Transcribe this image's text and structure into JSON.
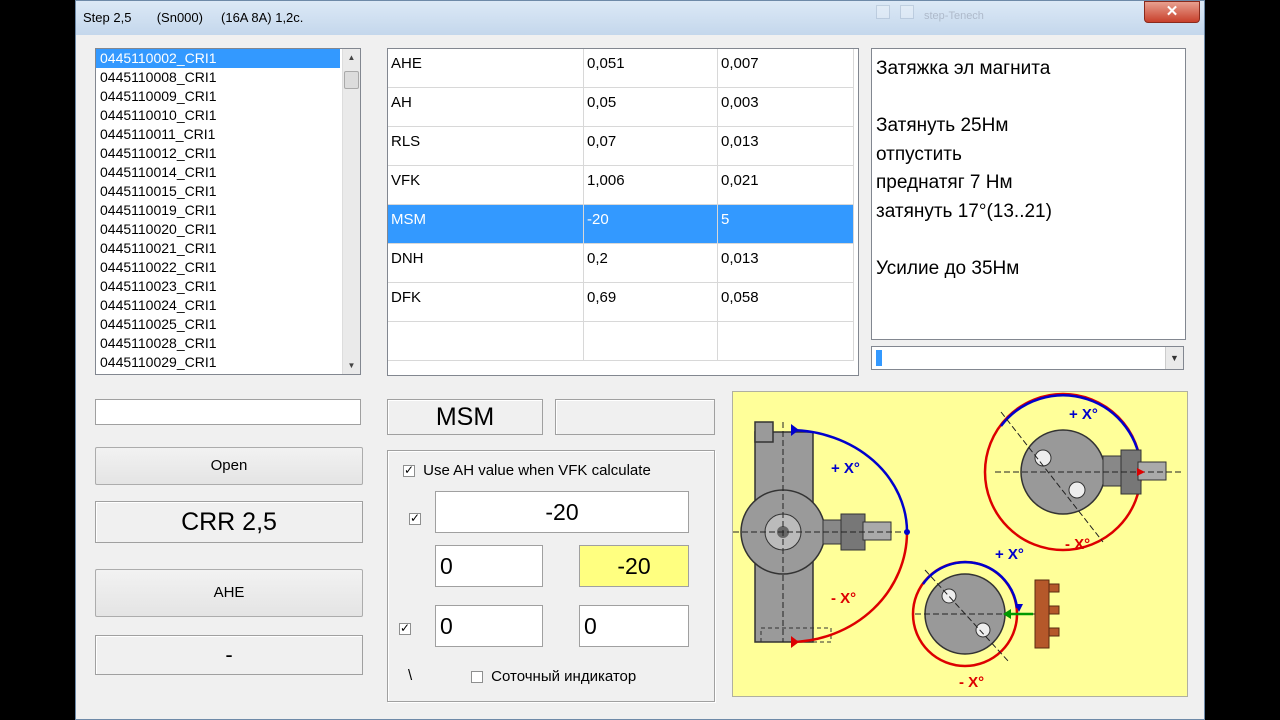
{
  "window": {
    "title": "Step 2,5       (Sn000)     (16A 8A) 1,2c.",
    "close_label": "✕",
    "ghost_title": "step-Tenech"
  },
  "parts_list": {
    "items": [
      "0445110002_CRI1",
      "0445110008_CRI1",
      "0445110009_CRI1",
      "0445110010_CRI1",
      "0445110011_CRI1",
      "0445110012_CRI1",
      "0445110014_CRI1",
      "0445110015_CRI1",
      "0445110019_CRI1",
      "0445110020_CRI1",
      "0445110021_CRI1",
      "0445110022_CRI1",
      "0445110023_CRI1",
      "0445110024_CRI1",
      "0445110025_CRI1",
      "0445110028_CRI1",
      "0445110029_CRI1"
    ],
    "selected_index": 0
  },
  "params_table": {
    "rows": [
      [
        "AHE",
        "0,051",
        "0,007"
      ],
      [
        "AH",
        "0,05",
        "0,003"
      ],
      [
        "RLS",
        "0,07",
        "0,013"
      ],
      [
        "VFK",
        "1,006",
        "0,021"
      ],
      [
        "MSM",
        "-20",
        "5"
      ],
      [
        "DNH",
        "0,2",
        "0,013"
      ],
      [
        "DFK",
        "0,69",
        "0,058"
      ],
      [
        "",
        "",
        ""
      ]
    ],
    "selected_row": 4
  },
  "instructions": {
    "text": "Затяжка эл магнита\n\nЗатянуть 25Нм\nотпустить\nпреднатяг 7 Нм\nзатянуть 17°(13..21)\n\nУсилие до 35Нм"
  },
  "left_controls": {
    "search_value": "",
    "open_label": "Open",
    "crr_label": "CRR 2,5",
    "ahe_label": "AHE",
    "dash_label": "-"
  },
  "measure": {
    "param_name": "MSM",
    "param_extra": "",
    "use_ah_label": "Use AH value  when VFK calculate",
    "main_value": "-20",
    "val_left_1": "0",
    "val_right_1": "-20",
    "val_left_2": "0",
    "val_right_2": "0",
    "backslash": "\\",
    "indicator_label": "Соточный индикатор",
    "highlight_color": "#ffff80"
  },
  "diagram": {
    "plus_label": "+ X°",
    "minus_label": "- X°",
    "bg_color": "#ffff99",
    "plus_color": "#0000cc",
    "minus_color": "#dd0000"
  }
}
